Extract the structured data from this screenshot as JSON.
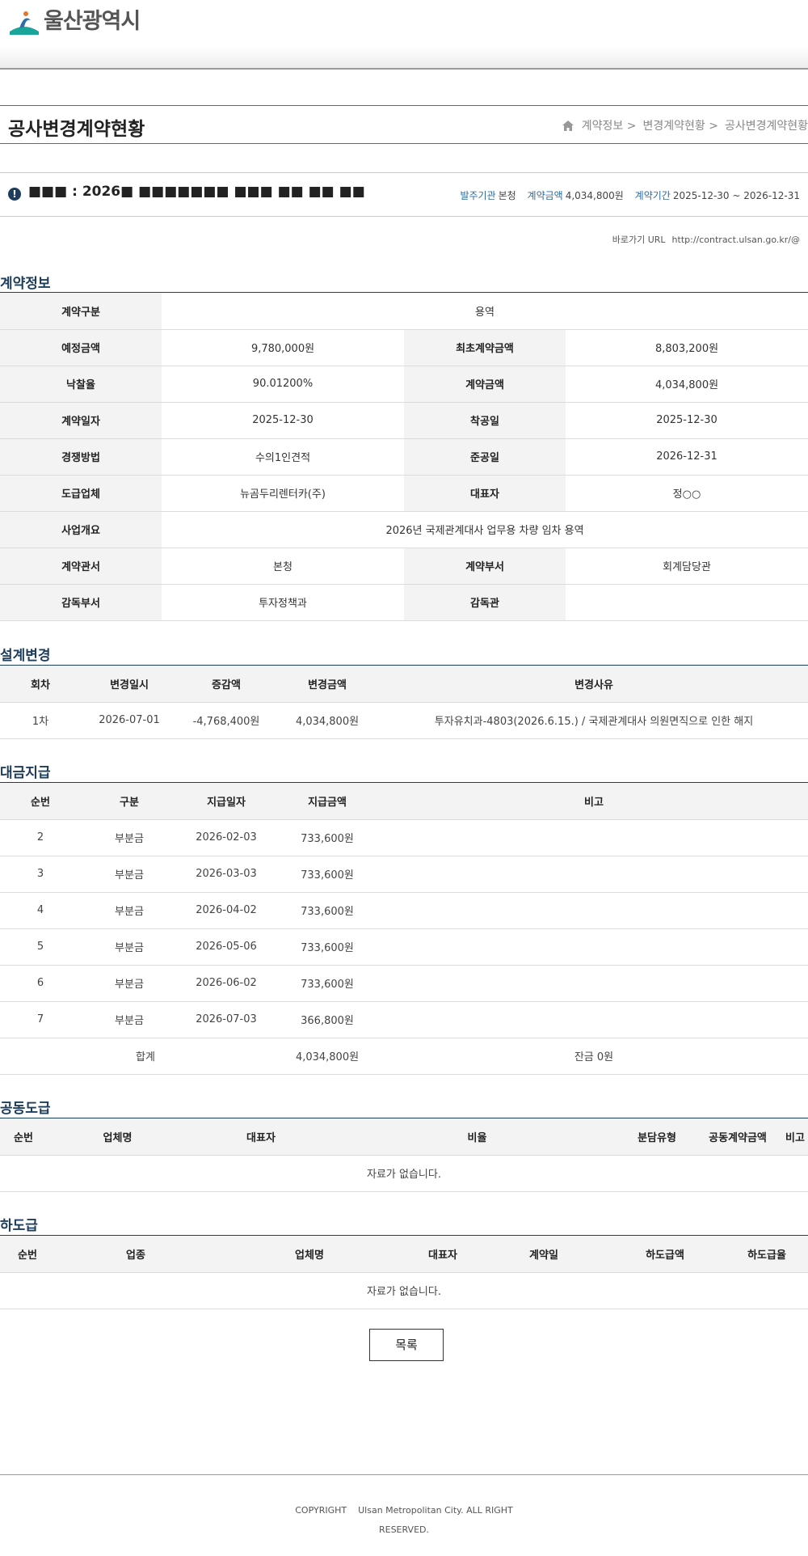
{
  "header": {
    "logo_text": "울산광역시"
  },
  "page": {
    "title": "공사변경계약현황",
    "breadcrumb": [
      "계약정보 >",
      "변경계약현황 >",
      "공사변경계약현황"
    ]
  },
  "contract": {
    "name": "■■■ : 2026■ ■■■■■■■ ■■■ ■■ ■■ ■■",
    "ordering_label": "발주기관",
    "ordering_value": "본청",
    "amount_label": "계약금액",
    "amount_value": "4,034,800원",
    "period_label": "계약기간",
    "period_value": "2025-12-30 ~ 2026-12-31",
    "url_label": "바로가기 URL",
    "url_value": "http://contract.ulsan.go.kr/@"
  },
  "info": {
    "title": "계약정보",
    "rows": [
      {
        "l1": "계약구분",
        "v1": "용역",
        "full": true
      },
      {
        "l1": "예정금액",
        "v1": "9,780,000원",
        "l2": "최초계약금액",
        "v2": "8,803,200원"
      },
      {
        "l1": "낙찰율",
        "v1": "90.01200%",
        "l2": "계약금액",
        "v2": "4,034,800원"
      },
      {
        "l1": "계약일자",
        "v1": "2025-12-30",
        "l2": "착공일",
        "v2": "2025-12-30"
      },
      {
        "l1": "경쟁방법",
        "v1": "수의1인견적",
        "l2": "준공일",
        "v2": "2026-12-31"
      },
      {
        "l1": "도급업체",
        "v1": "뉴곰두리렌터카(주)",
        "l2": "대표자",
        "v2": "정○○"
      },
      {
        "l1": "사업개요",
        "v1": "2026년 국제관계대사 업무용 차량 임차 용역",
        "full": true
      },
      {
        "l1": "계약관서",
        "v1": "본청",
        "l2": "계약부서",
        "v2": "회계담당관"
      },
      {
        "l1": "감독부서",
        "v1": "투자정책과",
        "l2": "감독관",
        "v2": ""
      }
    ]
  },
  "design_change": {
    "title": "설계변경",
    "headers": [
      "회차",
      "변경일시",
      "증감액",
      "변경금액",
      "변경사유"
    ],
    "rows": [
      [
        "1차",
        "2026-07-01",
        "-4,768,400원",
        "4,034,800원",
        "투자유치과-4803(2026.6.15.) / 국제관계대사 의원면직으로 인한 해지"
      ]
    ]
  },
  "payment": {
    "title": "대금지급",
    "headers": [
      "순번",
      "구분",
      "지급일자",
      "지급금액",
      "비고"
    ],
    "rows": [
      [
        "2",
        "부분금",
        "2026-02-03",
        "733,600원",
        ""
      ],
      [
        "3",
        "부분금",
        "2026-03-03",
        "733,600원",
        ""
      ],
      [
        "4",
        "부분금",
        "2026-04-02",
        "733,600원",
        ""
      ],
      [
        "5",
        "부분금",
        "2026-05-06",
        "733,600원",
        ""
      ],
      [
        "6",
        "부분금",
        "2026-06-02",
        "733,600원",
        ""
      ],
      [
        "7",
        "부분금",
        "2026-07-03",
        "366,800원",
        ""
      ]
    ],
    "total_label": "합계",
    "total_value": "4,034,800원",
    "balance": "잔금 0원"
  },
  "joint": {
    "title": "공동도급",
    "headers": [
      "순번",
      "업체명",
      "대표자",
      "비율",
      "분담유형",
      "공동계약금액",
      "비고"
    ],
    "empty": "자료가 없습니다."
  },
  "subcontract": {
    "title": "하도급",
    "headers": [
      "순번",
      "업종",
      "업체명",
      "대표자",
      "계약일",
      "하도급액",
      "하도급율"
    ],
    "empty": "자료가 없습니다."
  },
  "buttons": {
    "list_label": "목록"
  },
  "footer": {
    "copyright": "COPYRIGHT",
    "org": "Ulsan Metropolitan City. ALL RIGHT",
    "reserved": "RESERVED."
  },
  "colors": {
    "accent_navy": "#1d3d5c",
    "link_blue": "#2d6ba3",
    "logo_teal": "#1aa59a"
  }
}
